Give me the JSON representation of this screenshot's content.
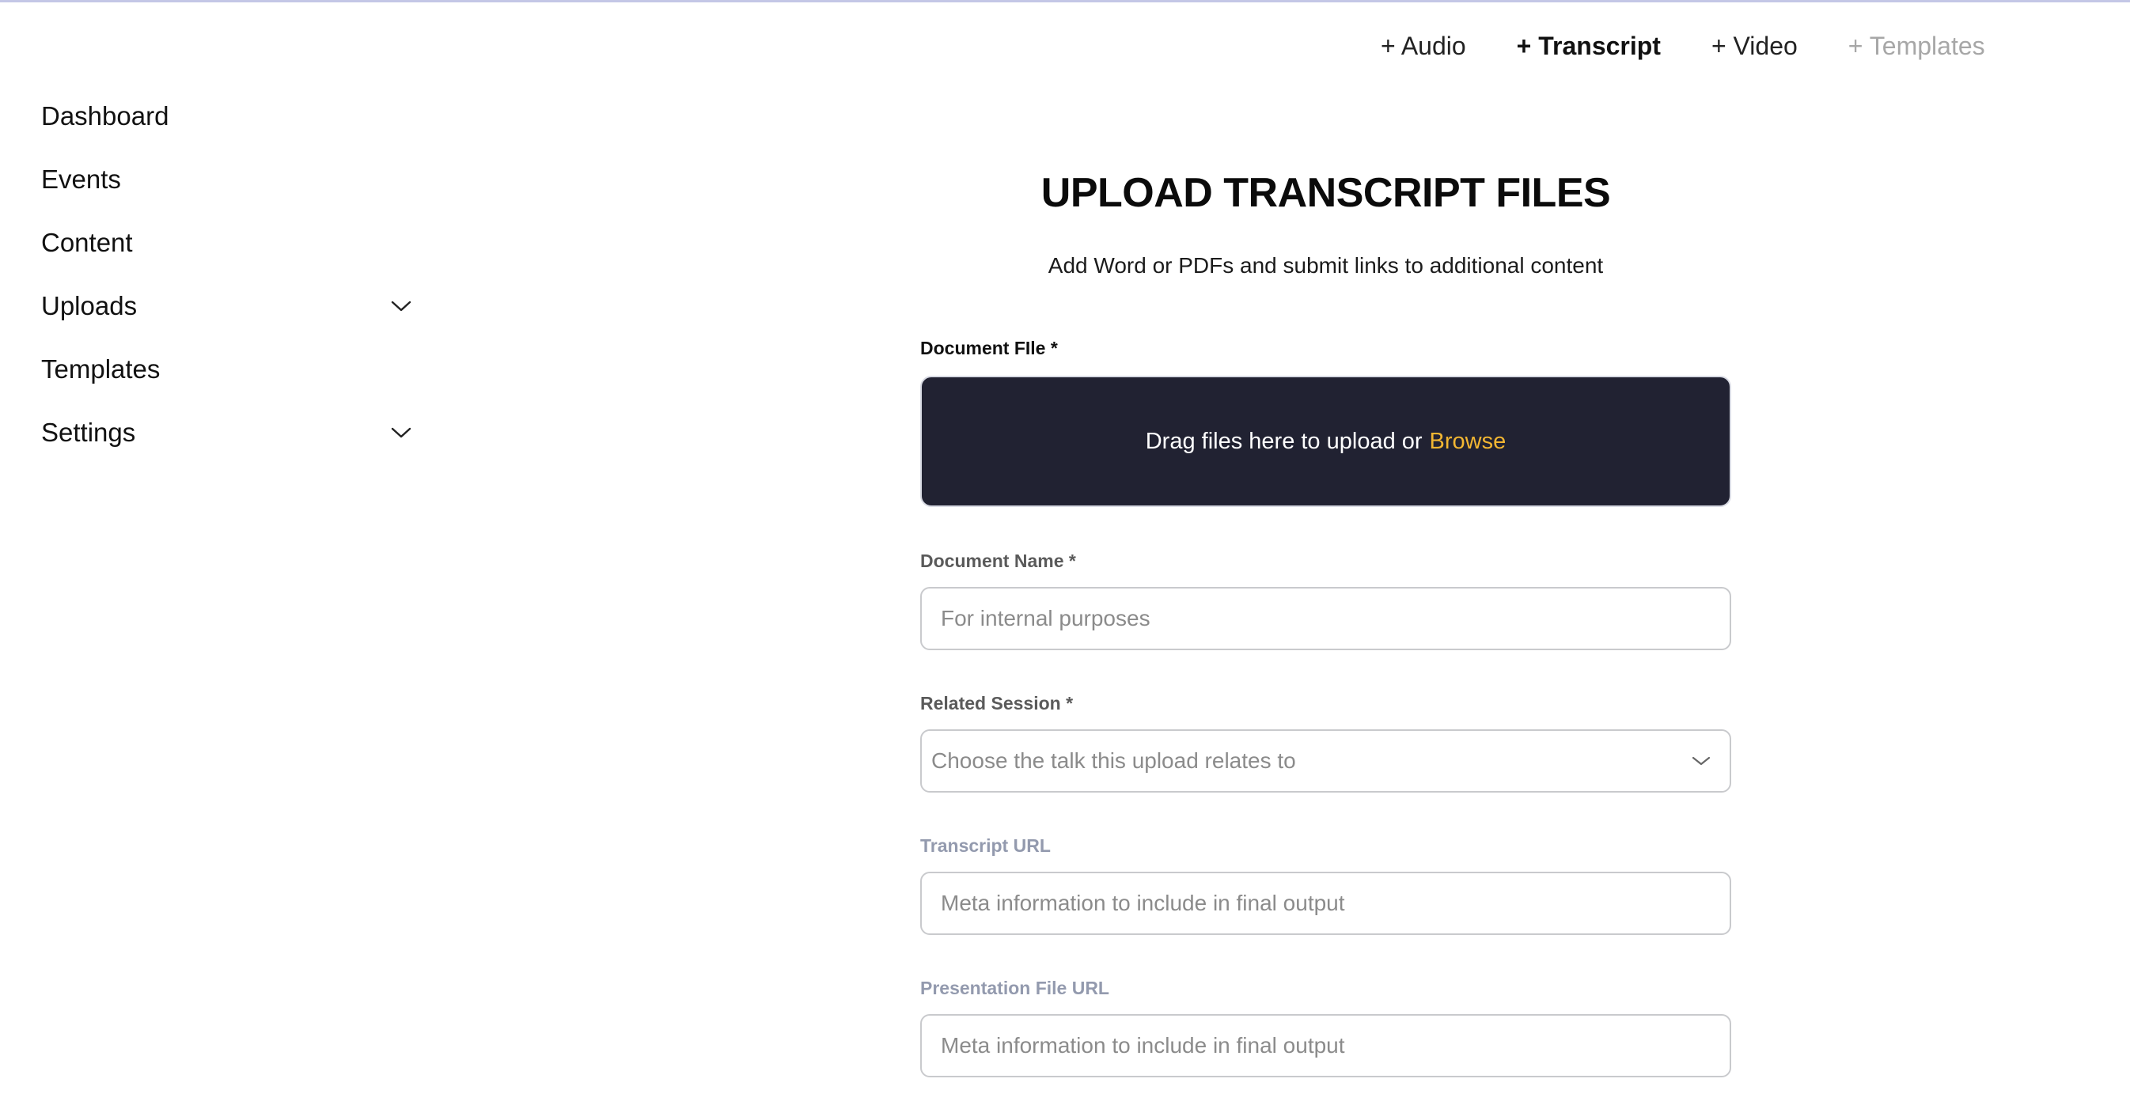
{
  "topnav": {
    "links": [
      {
        "label": "+ Audio",
        "state": "normal"
      },
      {
        "label": "+ Transcript",
        "state": "active"
      },
      {
        "label": "+ Video",
        "state": "normal"
      },
      {
        "label": "+ Templates",
        "state": "muted"
      }
    ]
  },
  "sidebar": {
    "items": [
      {
        "label": "Dashboard",
        "icon": null
      },
      {
        "label": "Events",
        "icon": null
      },
      {
        "label": "Content",
        "icon": null
      },
      {
        "label": "Uploads",
        "icon": "chevron-down-icon"
      },
      {
        "label": "Templates",
        "icon": null
      },
      {
        "label": "Settings",
        "icon": "chevron-down-icon"
      }
    ]
  },
  "main": {
    "title": "UPLOAD TRANSCRIPT FILES",
    "subtitle": "Add Word or PDFs and submit links to additional content",
    "document_file": {
      "label": "Document FIle *",
      "dropzone_text": "Drag files here to upload or",
      "browse_label": "Browse"
    },
    "document_name": {
      "label": "Document Name *",
      "placeholder": "For internal purposes",
      "value": ""
    },
    "related_session": {
      "label": "Related Session *",
      "placeholder": "Choose the talk this upload relates to"
    },
    "transcript_url": {
      "label": "Transcript URL",
      "placeholder": "Meta information to include in final output",
      "value": ""
    },
    "presentation_url": {
      "label": "Presentation File URL",
      "placeholder": "Meta information to include in final output",
      "value": ""
    }
  },
  "colors": {
    "dropzone_bg": "#212232",
    "browse_accent": "#f2b632",
    "muted_label": "#939aae"
  }
}
